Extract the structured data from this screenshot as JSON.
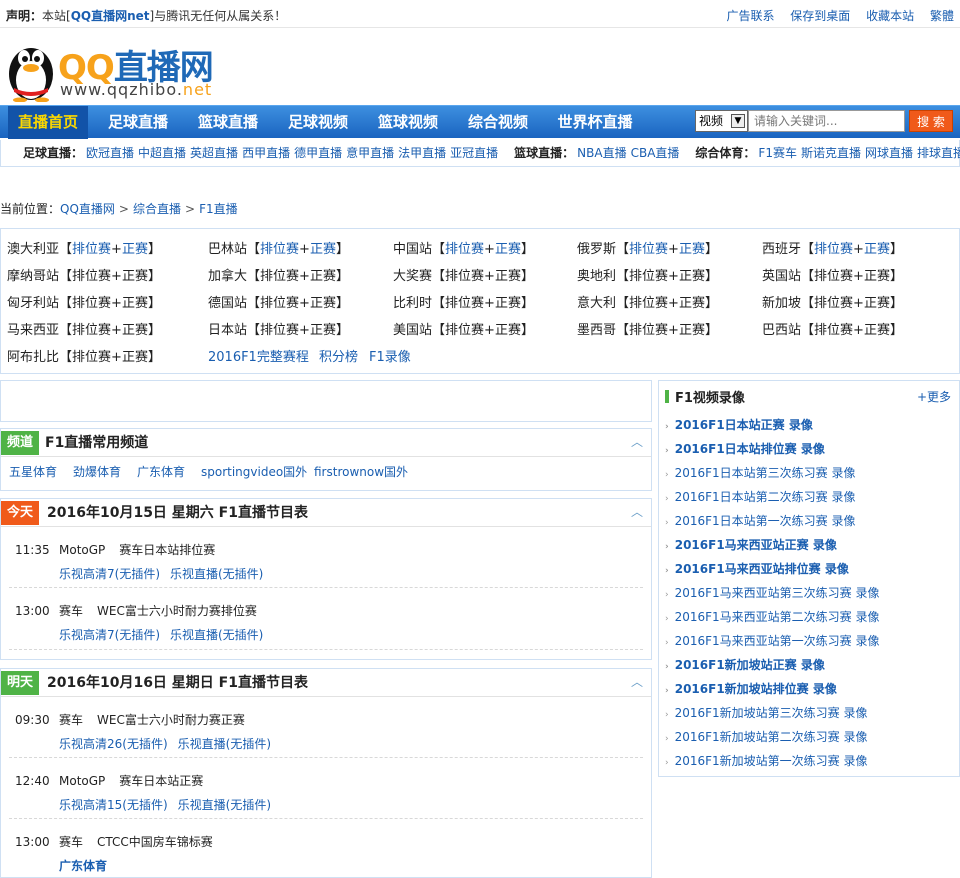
{
  "topbar": {
    "notice_label": "声明：",
    "notice_pre": "本站[",
    "notice_site": "QQ直播网net",
    "notice_post": "]与腾讯无任何从属关系！",
    "links": [
      "广告联系",
      "保存到桌面",
      "收藏本站",
      "繁體"
    ]
  },
  "logo": {
    "brand_qq": "QQ",
    "brand_cn": "直播网",
    "url_main": "www.qqzhibo.",
    "url_tld": "net"
  },
  "nav": {
    "items": [
      "直播首页",
      "足球直播",
      "篮球直播",
      "足球视频",
      "篮球视频",
      "综合视频",
      "世界杯直播"
    ]
  },
  "search": {
    "select_value": "视频",
    "placeholder": "请输入关键词...",
    "button_label": "搜 索"
  },
  "subnav": {
    "football_label": "足球直播：",
    "football_links": [
      "欧冠直播",
      "中超直播",
      "英超直播",
      "西甲直播",
      "德甲直播",
      "意甲直播",
      "法甲直播",
      "亚冠直播"
    ],
    "basketball_label": "篮球直播：",
    "basketball_links": [
      "NBA直播",
      "CBA直播"
    ],
    "sports_label": "综合体育：",
    "sports_links": [
      "F1赛车",
      "斯诺克直播",
      "网球直播",
      "排球直播"
    ]
  },
  "breadcrumb": {
    "label": "当前位置：",
    "items": [
      "QQ直播网",
      "综合直播",
      "F1直播"
    ],
    "sep": ">"
  },
  "races": {
    "items": [
      "澳大利亚",
      "巴林站",
      "中国站",
      "俄罗斯",
      "西班牙",
      "摩纳哥站",
      "加拿大",
      "大奖赛",
      "奥地利",
      "英国站",
      "匈牙利站",
      "德国站",
      "比利时",
      "意大利",
      "新加坡",
      "马来西亚",
      "日本站",
      "美国站",
      "墨西哥",
      "巴西站",
      "阿布扎比"
    ],
    "bracket_open": "【",
    "qual": "排位赛",
    "plus": "+",
    "race": "正赛",
    "bracket_close": "】",
    "extras": [
      "2016F1完整赛程",
      "积分榜",
      "F1录像"
    ]
  },
  "channels": {
    "tag": "频道",
    "title": "F1直播常用频道",
    "items": [
      "五星体育",
      "劲爆体育",
      "广东体育",
      "sportingvideo国外",
      "firstrownow国外"
    ]
  },
  "today": {
    "tag": "今天",
    "title": "2016年10月15日 星期六 F1直播节目表",
    "programs": [
      {
        "time": "11:35",
        "cat": "MotoGP",
        "name": "赛车日本站排位赛",
        "links": [
          "乐视高清7(无插件)",
          "乐视直播(无插件)"
        ]
      },
      {
        "time": "13:00",
        "cat": "赛车",
        "name": "WEC富士六小时耐力赛排位赛",
        "links": [
          "乐视高清7(无插件)",
          "乐视直播(无插件)"
        ]
      }
    ]
  },
  "tomorrow": {
    "tag": "明天",
    "title": "2016年10月16日 星期日 F1直播节目表",
    "programs": [
      {
        "time": "09:30",
        "cat": "赛车",
        "name": "WEC富士六小时耐力赛正赛",
        "links": [
          "乐视高清26(无插件)",
          "乐视直播(无插件)"
        ]
      },
      {
        "time": "12:40",
        "cat": "MotoGP",
        "name": "赛车日本站正赛",
        "links": [
          "乐视高清15(无插件)",
          "乐视直播(无插件)"
        ]
      },
      {
        "time": "13:00",
        "cat": "赛车",
        "name": "CTCC中国房车锦标赛",
        "links": [
          "广东体育"
        ]
      }
    ]
  },
  "sidebar": {
    "title": "F1视频录像",
    "more": "+更多",
    "items": [
      {
        "text": "2016F1日本站正赛 录像",
        "bold": true
      },
      {
        "text": "2016F1日本站排位赛 录像",
        "bold": true
      },
      {
        "text": "2016F1日本站第三次练习赛 录像",
        "bold": false
      },
      {
        "text": "2016F1日本站第二次练习赛 录像",
        "bold": false
      },
      {
        "text": "2016F1日本站第一次练习赛 录像",
        "bold": false
      },
      {
        "text": "2016F1马来西亚站正赛 录像",
        "bold": true
      },
      {
        "text": "2016F1马来西亚站排位赛 录像",
        "bold": true
      },
      {
        "text": "2016F1马来西亚站第三次练习赛 录像",
        "bold": false
      },
      {
        "text": "2016F1马来西亚站第二次练习赛 录像",
        "bold": false
      },
      {
        "text": "2016F1马来西亚站第一次练习赛 录像",
        "bold": false
      },
      {
        "text": "2016F1新加坡站正赛 录像",
        "bold": true
      },
      {
        "text": "2016F1新加坡站排位赛 录像",
        "bold": true
      },
      {
        "text": "2016F1新加坡站第三次练习赛 录像",
        "bold": false
      },
      {
        "text": "2016F1新加坡站第二次练习赛 录像",
        "bold": false
      },
      {
        "text": "2016F1新加坡站第一次练习赛 录像",
        "bold": false
      }
    ]
  },
  "colors": {
    "nav_blue": "#1a64c0",
    "link_blue": "#1a5eb0",
    "today_tag": "#f05a1a",
    "channel_tag": "#4fb346",
    "nav_active": "#fcd800"
  }
}
